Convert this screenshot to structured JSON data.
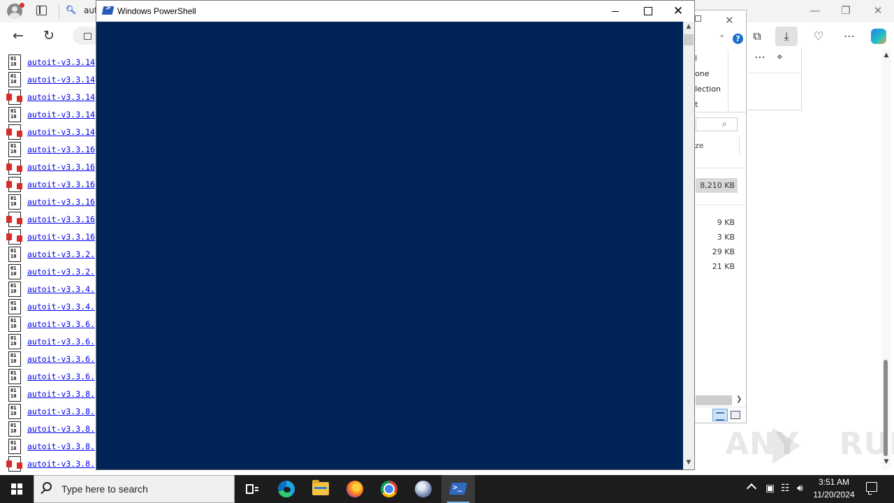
{
  "browser": {
    "tab_title": "aut",
    "file_links": [
      {
        "text": "autoit-v3.3.14",
        "type": "bin"
      },
      {
        "text": "autoit-v3.3.14",
        "type": "bin"
      },
      {
        "text": "autoit-v3.3.14",
        "type": "exe"
      },
      {
        "text": "autoit-v3.3.14",
        "type": "bin"
      },
      {
        "text": "autoit-v3.3.14",
        "type": "exe"
      },
      {
        "text": "autoit-v3.3.16",
        "type": "bin"
      },
      {
        "text": "autoit-v3.3.16",
        "type": "exe"
      },
      {
        "text": "autoit-v3.3.16",
        "type": "exe"
      },
      {
        "text": "autoit-v3.3.16",
        "type": "bin"
      },
      {
        "text": "autoit-v3.3.16",
        "type": "exe"
      },
      {
        "text": "autoit-v3.3.16",
        "type": "exe"
      },
      {
        "text": "autoit-v3.3.2.",
        "type": "bin"
      },
      {
        "text": "autoit-v3.3.2.",
        "type": "bin"
      },
      {
        "text": "autoit-v3.3.4.",
        "type": "bin"
      },
      {
        "text": "autoit-v3.3.4.",
        "type": "bin"
      },
      {
        "text": "autoit-v3.3.6.",
        "type": "bin"
      },
      {
        "text": "autoit-v3.3.6.",
        "type": "bin"
      },
      {
        "text": "autoit-v3.3.6.",
        "type": "bin"
      },
      {
        "text": "autoit-v3.3.6.",
        "type": "bin"
      },
      {
        "text": "autoit-v3.3.8.",
        "type": "bin"
      },
      {
        "text": "autoit-v3.3.8.",
        "type": "bin"
      },
      {
        "text": "autoit-v3.3.8.",
        "type": "bin"
      },
      {
        "text": "autoit-v3.3.8.",
        "type": "bin"
      },
      {
        "text": "autoit-v3.3.8.",
        "type": "exe"
      }
    ]
  },
  "explorer": {
    "ribbon_fragments": [
      "l",
      "one",
      "lection",
      "t"
    ],
    "column_fragment": "ze",
    "selected_size": "8,210 KB",
    "sizes": [
      "9 KB",
      "3 KB",
      "29 KB",
      "21 KB"
    ]
  },
  "powershell": {
    "title": "Windows PowerShell",
    "console_bg": "#012456"
  },
  "watermark": {
    "text_left": "ANY",
    "text_right": "RUN"
  },
  "taskbar": {
    "search_placeholder": "Type here to search",
    "time": "3:51 AM",
    "date": "11/20/2024"
  },
  "colors": {
    "link": "#0000ee",
    "taskbar": "#1c1c1c",
    "accent": "#76b9ed"
  }
}
